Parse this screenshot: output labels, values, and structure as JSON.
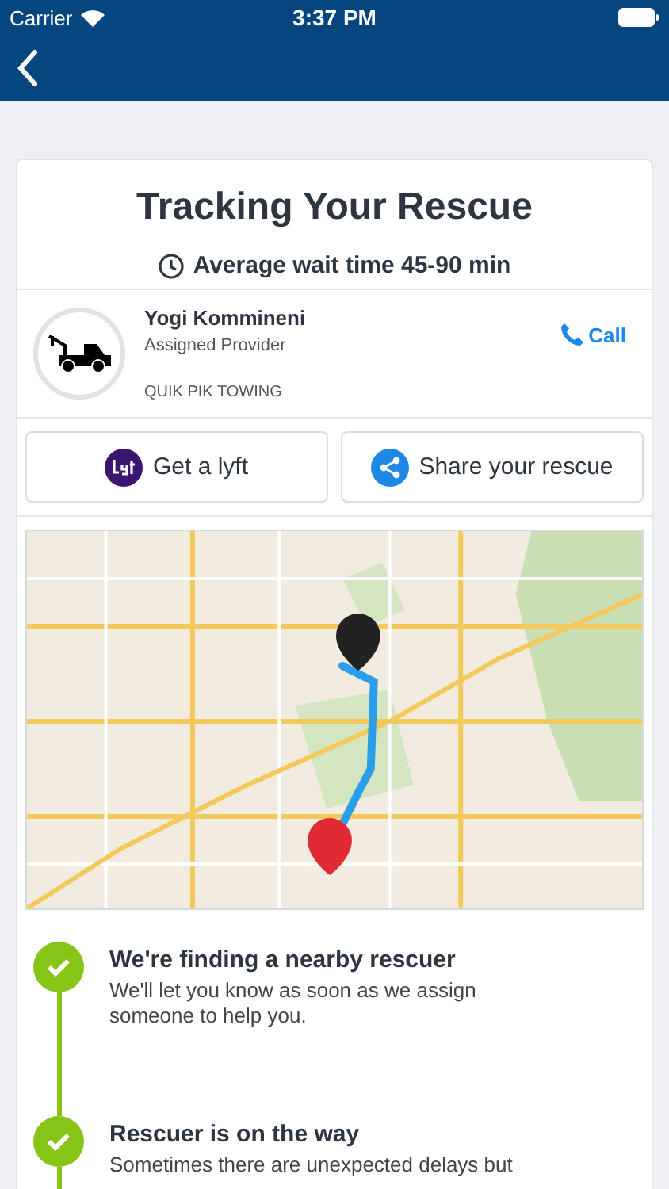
{
  "status_bar": {
    "carrier": "Carrier",
    "time": "3:37 PM"
  },
  "title": "Tracking Your Rescue",
  "wait_time": "Average wait time 45-90 min",
  "provider": {
    "name": "Yogi Kommineni",
    "role": "Assigned Provider",
    "company": "QUIK PIK TOWING",
    "call": "Call"
  },
  "actions": [
    {
      "kind": "lyft",
      "label": "Get a lyft"
    },
    {
      "kind": "share",
      "label": "Share your rescue"
    }
  ],
  "steps": [
    {
      "title": "We're finding a nearby rescuer",
      "description": "We'll let you know as soon as we assign someone to help you.",
      "completed": true
    },
    {
      "title": "Rescuer is on the way",
      "description": "Sometimes there are unexpected delays but",
      "completed": true
    }
  ]
}
